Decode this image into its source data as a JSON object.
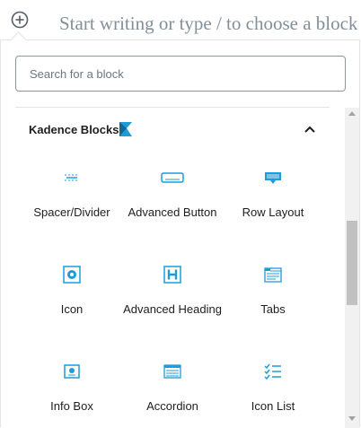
{
  "editor": {
    "inserter_icon": "plus-circle-icon",
    "placeholder": "Start writing or type / to choose a block"
  },
  "search": {
    "placeholder": "Search for a block",
    "value": ""
  },
  "panel": {
    "title": "Kadence Blocks",
    "logo_icon": "kadence-logo-icon",
    "logo_color": "#1e9cd7",
    "toggle_icon": "chevron-up-icon",
    "expanded": true
  },
  "blocks": [
    {
      "label": "Spacer/Divider",
      "icon": "spacer-divider-icon"
    },
    {
      "label": "Advanced Button",
      "icon": "advanced-button-icon"
    },
    {
      "label": "Row Layout",
      "icon": "row-layout-icon"
    },
    {
      "label": "Icon",
      "icon": "icon-block-icon"
    },
    {
      "label": "Advanced Heading",
      "icon": "advanced-heading-icon"
    },
    {
      "label": "Tabs",
      "icon": "tabs-icon"
    },
    {
      "label": "Info Box",
      "icon": "info-box-icon"
    },
    {
      "label": "Accordion",
      "icon": "accordion-icon"
    },
    {
      "label": "Icon List",
      "icon": "icon-list-icon"
    }
  ],
  "colors": {
    "accent": "#1e9cd7",
    "text": "#1e1e1e",
    "placeholder": "#828f99"
  }
}
